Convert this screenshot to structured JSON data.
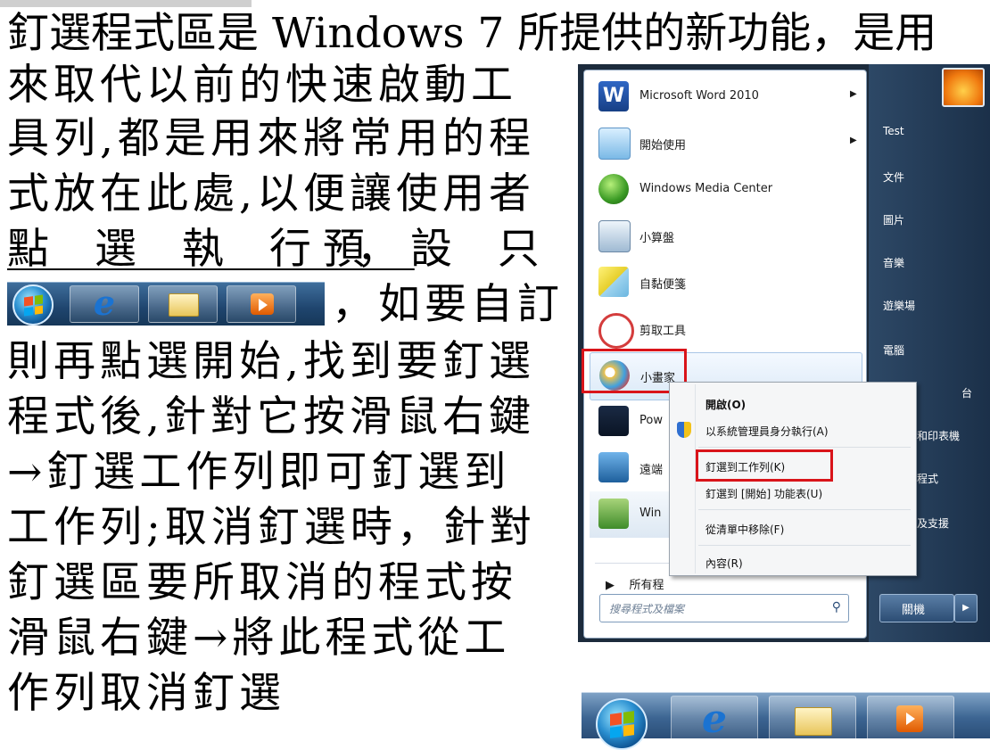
{
  "paragraph": {
    "line1": "釘選程式區是 Windows 7 所提供的新功能，是用",
    "line2": "來取代以前的快速啟動工",
    "line3": "具列,都是用來將常用的程",
    "line4": "式放在此處,以便讓使用者",
    "line5a": "點 選 執 行 ，",
    "line5b": "預 設 只 有",
    "line6": "，如要自訂",
    "line7": "則再點選開始,找到要釘選",
    "line8": "程式後,針對它按滑鼠右鍵",
    "line9": "→釘選工作列即可釘選到",
    "line10": "工作列;取消釘選時，針對",
    "line11": "釘選區要所取消的程式按",
    "line12": "滑鼠右鍵→將此程式從工",
    "line13": "作列取消釘選"
  },
  "start_menu": {
    "items": [
      {
        "label": "Microsoft Word 2010",
        "icon": "word-icon",
        "has_arrow": true
      },
      {
        "label": "開始使用",
        "icon": "getting-started-icon",
        "has_arrow": true
      },
      {
        "label": "Windows Media Center",
        "icon": "media-center-icon",
        "has_arrow": false
      },
      {
        "label": "小算盤",
        "icon": "calculator-icon",
        "has_arrow": false
      },
      {
        "label": "自黏便箋",
        "icon": "sticky-notes-icon",
        "has_arrow": false
      },
      {
        "label": "剪取工具",
        "icon": "snipping-tool-icon",
        "has_arrow": false
      },
      {
        "label": "小畫家",
        "icon": "paint-icon",
        "has_arrow": false
      },
      {
        "label": "Pow",
        "icon": "dvd-maker-icon",
        "has_arrow": false
      },
      {
        "label": "遠端",
        "icon": "remote-desktop-icon",
        "has_arrow": false
      },
      {
        "label": "Win",
        "icon": "windows-update-icon",
        "has_arrow": false
      }
    ],
    "all_programs": "所有程",
    "search_placeholder": "搜尋程式及檔案",
    "right_links": [
      "Test",
      "文件",
      "圖片",
      "音樂",
      "遊樂場",
      "電腦",
      "台",
      "和印表機",
      "程式",
      "及支援"
    ],
    "shutdown_label": "關機",
    "shutdown_arrow": "▶"
  },
  "context_menu": {
    "items": [
      "開啟(O)",
      "以系統管理員身分執行(A)",
      "釘選到工作列(K)",
      "釘選到 [開始] 功能表(U)",
      "從清單中移除(F)",
      "內容(R)"
    ]
  },
  "colors": {
    "highlight_box": "#d9141a",
    "taskbar_blue": "#1f456e",
    "menu_dark": "#1c2b3c"
  }
}
